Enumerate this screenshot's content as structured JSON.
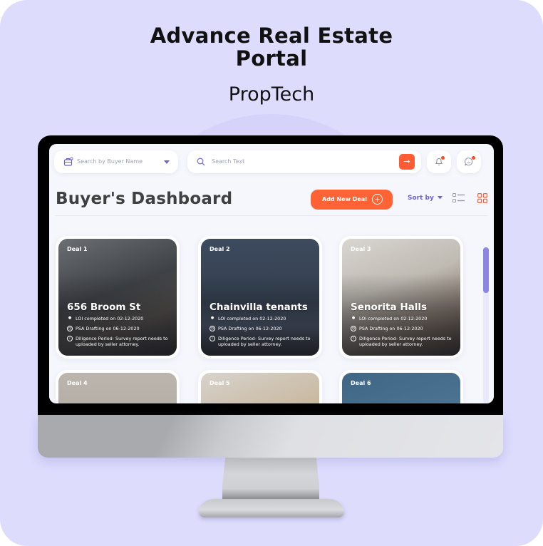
{
  "header": {
    "title_line1": "Advance Real Estate",
    "title_line2": "Portal",
    "subtitle": "PropTech"
  },
  "app": {
    "buyer_search": {
      "placeholder": "Search by Buyer Name",
      "icon": "briefcase-icon"
    },
    "text_search": {
      "placeholder": "Search Text",
      "icon": "search-icon",
      "submit_icon": "arrow-right-icon"
    },
    "notifications": {
      "icon": "bell-icon",
      "has_unread": true
    },
    "messages": {
      "icon": "chat-icon",
      "has_unread": true
    },
    "page_title": "Buyer's Dashboard",
    "add_button": "Add New Deal",
    "sort_label": "Sort by",
    "view_modes": [
      "list",
      "grid"
    ],
    "active_view": "grid",
    "scroll_position": 0.0,
    "colors": {
      "accent": "#ff6235",
      "primary": "#6a62d6",
      "scrollbar": "#8b86e2",
      "background": "#dddcfd"
    }
  },
  "deals": [
    {
      "label": "Deal 1",
      "name": "656 Broom St",
      "loi": "LOI completed on 02-12-2020",
      "psa": "PSA Drafting on 06-12-2020",
      "diligence": "Diligence Period- Survey report needs to uploaded by seller attorney.",
      "bg": "#4a4d52"
    },
    {
      "label": "Deal 2",
      "name": "Chainvilla tenants",
      "loi": "LOI completed on 02-12-2020",
      "psa": "PSA Drafting on 06-12-2020",
      "diligence": "Diligence Period- Survey report needs to uploaded by seller attorney.",
      "bg": "#3a4659"
    },
    {
      "label": "Deal 3",
      "name": "Senorita Halls",
      "loi": "LOI completed on 02-12-2020",
      "psa": "PSA Drafting on 06-12-2020",
      "diligence": "Diligence Period- Survey report needs to uploaded by seller attorney.",
      "bg": "#7a7470"
    },
    {
      "label": "Deal 4",
      "bg": "#b9b2ab"
    },
    {
      "label": "Deal 5",
      "bg": "#c9c4bd"
    },
    {
      "label": "Deal 6",
      "bg": "#466c8c"
    }
  ]
}
